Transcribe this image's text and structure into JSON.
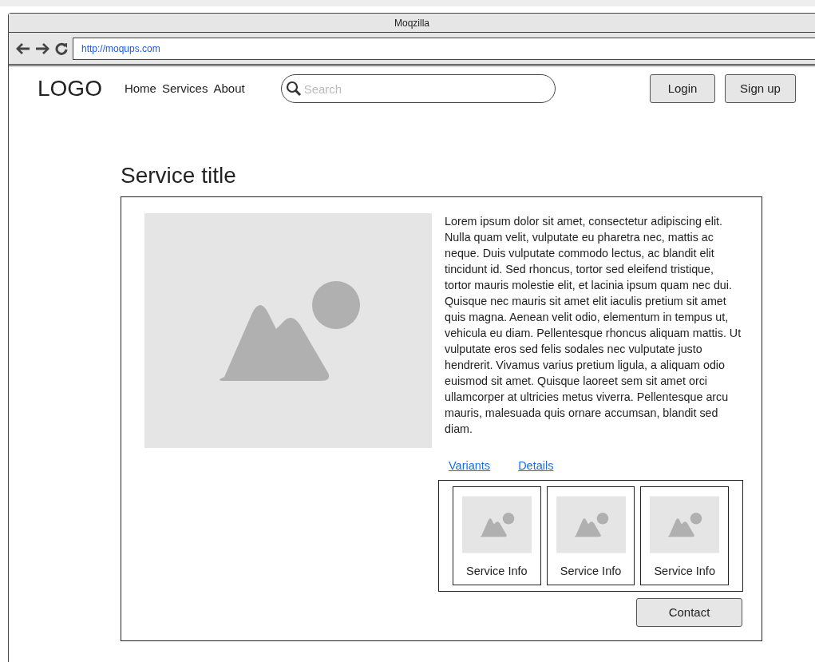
{
  "window": {
    "title": "Moqzilla"
  },
  "address_bar": {
    "url": "http://moqups.com"
  },
  "header": {
    "logo": "LOGO",
    "nav": [
      "Home",
      "Services",
      "About"
    ],
    "search": {
      "placeholder": "Search"
    },
    "buttons": [
      "Login",
      "Sign up"
    ]
  },
  "service": {
    "title": "Service title",
    "description": "Lorem ipsum dolor sit amet, consectetur adipiscing elit. Nulla quam velit, vulputate eu pharetra nec, mattis ac neque. Duis vulputate commodo lectus, ac blandit elit tincidunt id. Sed rhoncus, tortor sed eleifend tristique, tortor mauris molestie elit, et lacinia ipsum quam nec dui. Quisque nec mauris sit amet elit iaculis pretium sit amet quis magna. Aenean velit odio, elementum in tempus ut, vehicula eu diam. Pellentesque rhoncus aliquam mattis. Ut vulputate eros sed felis sodales nec vulputate justo hendrerit. Vivamus varius pretium ligula, a aliquam odio euismod sit amet. Quisque laoreet sem sit amet orci ullamcorper at ultricies metus viverra. Pellentesque arcu mauris, malesuada quis ornare accumsan, blandit sed diam.",
    "links": [
      "Variants",
      "Details"
    ],
    "cards": [
      {
        "label": "Service Info"
      },
      {
        "label": "Service Info"
      },
      {
        "label": "Service Info"
      }
    ],
    "contact_button": "Contact"
  }
}
